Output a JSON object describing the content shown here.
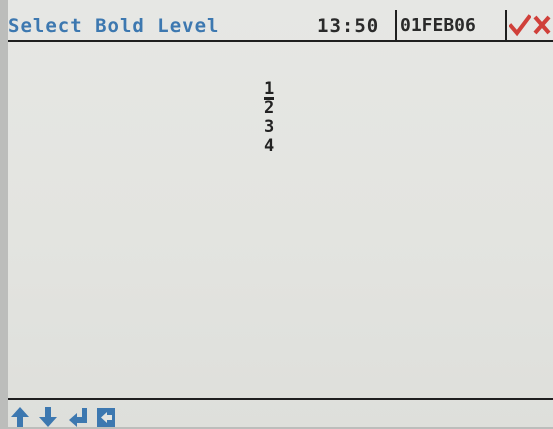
{
  "header": {
    "title": "Select Bold Level",
    "time": "13:50",
    "date": "01FEB06",
    "ok_icon": "checkmark-icon",
    "cancel_icon": "x-icon"
  },
  "bold_levels": {
    "selected": "1",
    "items": [
      "1",
      "2",
      "3",
      "4"
    ]
  },
  "footer": {
    "icons": [
      "up-arrow-icon",
      "down-arrow-icon",
      "enter-icon",
      "back-icon"
    ]
  },
  "colors": {
    "accent": "#3d78b0",
    "confirm": "#d0403a",
    "screen_bg": "#e4e5e1",
    "text": "#222222"
  }
}
